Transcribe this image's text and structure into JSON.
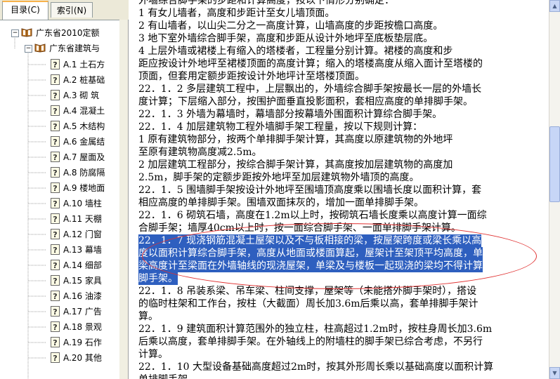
{
  "left_panel": {
    "tabs": [
      {
        "label": "目录(C)"
      },
      {
        "label": "索引(N)"
      }
    ],
    "tree": {
      "root": {
        "label": "广东省2010定额"
      },
      "child": {
        "label": "广东省建筑与"
      },
      "items": [
        {
          "label": "A.1 土石方"
        },
        {
          "label": "A.2 桩基础"
        },
        {
          "label": "A.3 砌 筑"
        },
        {
          "label": "A.4 混凝土"
        },
        {
          "label": "A.5 木结构"
        },
        {
          "label": "A.6 金属结"
        },
        {
          "label": "A.7 屋面及"
        },
        {
          "label": "A.8 防腐隔"
        },
        {
          "label": "A.9 楼地面"
        },
        {
          "label": "A.10 墙柱"
        },
        {
          "label": "A.11 天棚"
        },
        {
          "label": "A.12 门窗"
        },
        {
          "label": "A.13 幕墙"
        },
        {
          "label": "A.14 细部"
        },
        {
          "label": "A.15 家具"
        },
        {
          "label": "A.16 油漆"
        },
        {
          "label": "A.17 广告"
        },
        {
          "label": "A.18 景观"
        },
        {
          "label": "A.19 石作"
        },
        {
          "label": "A.20 其他"
        }
      ]
    }
  },
  "content": {
    "lines": [
      "外墙综合脚手架的步距和计算高度，按以下情形分别确定：",
      "  1  有女儿墙者，高度和步距计至女儿墙顶面。",
      "  2  有山墙者，以山尖二分之一高度计算，山墙高度的步距按檐口高度。",
      "  3  地下室外墙综合脚手架，高度和步距从设计外地坪至底板垫层底。",
      "  4  上层外墙或裙楼上有缩入的塔楼者，工程量分别计算。裙楼的高度和步",
      "距应按设计外地坪至裙楼顶面的高度计算；缩入的塔楼高度从缩入面计至塔楼的",
      "顶面，但套用定额步距按设计外地坪计至塔楼顶面。",
      "22．1．2  多层建筑工程中，上层飘出的，外墙综合脚手架按最长一层的外墙长",
      "度计算；下层缩入部分，按围护面垂直投影面积，套相应高度的单排脚手架。",
      "22．1．3  外墙为幕墙时，幕墙部分按幕墙外围面积计算综合脚手架。",
      "22．1．4  加层建筑物工程外墙脚手架工程量，按以下规则计算：",
      "  1  原有建筑物部分，按两个单排脚手架计算，其高度以原建筑物的外地坪",
      "至原有建筑物高度减2.5m。",
      "  2  加层建筑工程部分，按综合脚手架计算，其高度按加层建筑物的高度加",
      "2.5m，脚手架的定额步距按外地坪至加层建筑物外墙顶的高度。",
      "22．1．5  围墙脚手架按设计外地坪至围墙顶高度乘以围墙长度以面积计算，套",
      "相应高度的单排脚手架。围墙双面抹灰的，增加一面单排脚手架。",
      "22．1．6  砌筑石墙，高度在1.2m以上时，按砌筑石墙长度乘以高度计算一面综",
      "合脚手架；墙厚40cm以上时，按一面综合脚手架、一面单排脚手架计算。",
      "22．1．7  现浇钢筋混凝土屋架以及不与板相接的梁，按屋架跨度或梁长乘以高",
      "度以面积计算综合脚手架，高度从地面或楼面算起，屋架计至架顶平均高度，单",
      "梁高度计至梁面在外墙轴线的现浇屋架，单梁及与楼板一起现浇的梁均不得计算",
      "脚手架。",
      "22．1．8  吊装系梁、吊车梁、柱间支撑，屋架等（未能搭外脚手架时），搭设",
      "的临时柱架和工作台，按柱（大截面）周长加3.6m后乘以高，套单排脚手架计",
      "算。",
      "22．1．9  建筑面积计算范围外的独立柱，柱高超过1.2m时，按柱身周长加3.6m",
      "后乘以高度，套单排脚手架。在外轴线上的附墙柱的脚手架已综合考虑，不另行",
      "计算。",
      "22．1．10  大型设备基础高度超过2m时，按其外形周长乘以基础高度以面积计算",
      "单排脚手架。"
    ]
  }
}
